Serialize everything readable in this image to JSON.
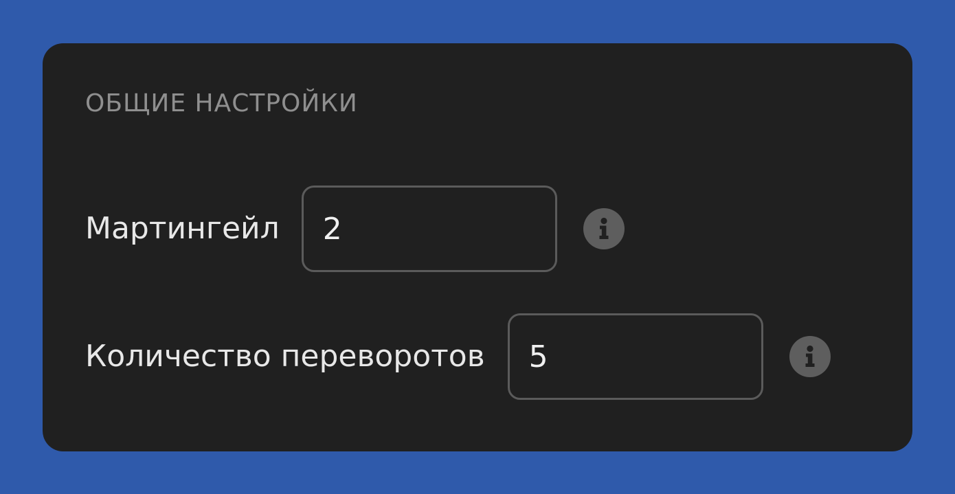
{
  "settings": {
    "section_title": "ОБЩИЕ НАСТРОЙКИ",
    "martingale": {
      "label": "Мартингейл",
      "value": "2",
      "info_icon": "info-icon"
    },
    "flips_count": {
      "label": "Количество переворотов",
      "value": "5",
      "info_icon": "info-icon"
    }
  },
  "colors": {
    "page_background": "#2f5aab",
    "panel_background": "#202020",
    "title_text": "#8f8f8f",
    "label_text": "#e8e8e8",
    "field_border": "#5b5b5b",
    "info_icon": "#5e5e5e"
  }
}
